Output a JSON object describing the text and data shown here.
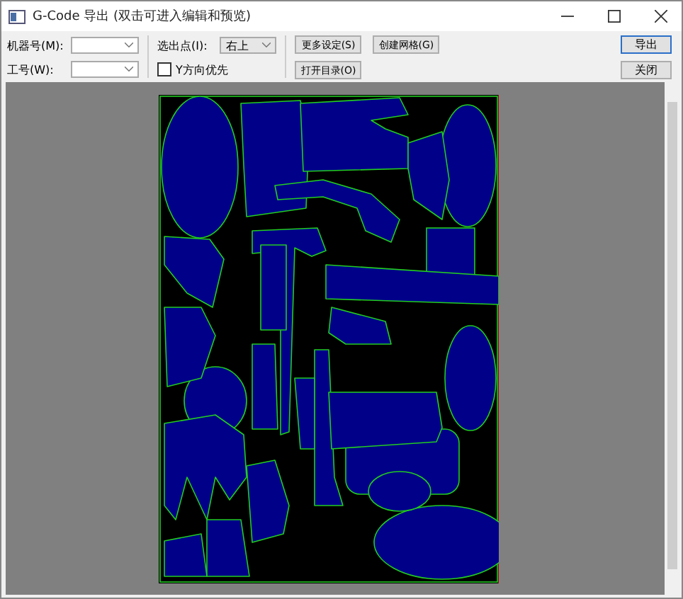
{
  "window": {
    "title": "G-Code 导出 (双击可进入编辑和预览)"
  },
  "fields": [
    {
      "label": "机器号(M):"
    },
    {
      "label": "工号(W):"
    }
  ],
  "exit_point": {
    "label": "选出点(I):",
    "value": "右上"
  },
  "checkbox": {
    "label": "Y方向优先",
    "checked": false
  },
  "middle_buttons": [
    {
      "label": "更多设定(S)"
    },
    {
      "label": "创建网格(G)"
    },
    {
      "label": "打开目录(O)"
    }
  ],
  "side_buttons": [
    {
      "label": "导出",
      "selected": true
    },
    {
      "label": "关闭",
      "selected": false
    }
  ]
}
